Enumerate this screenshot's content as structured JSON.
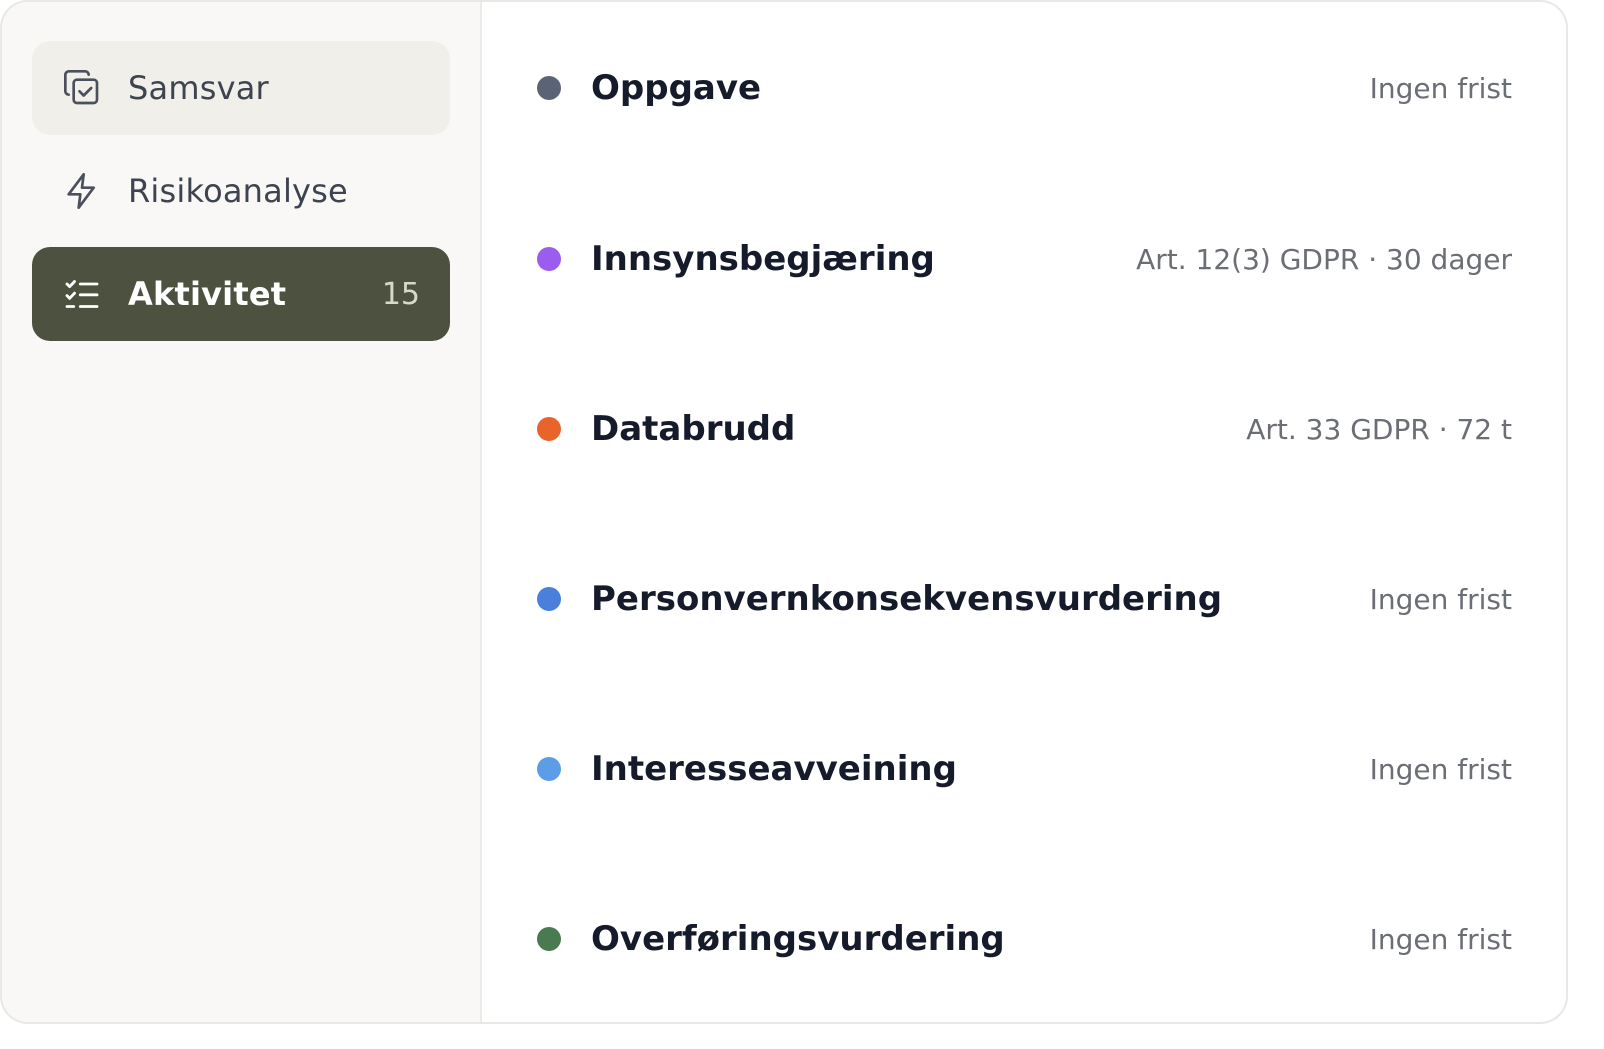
{
  "sidebar": {
    "items": [
      {
        "label": "Samsvar",
        "icon": "compliance-check-icon",
        "state": "hover"
      },
      {
        "label": "Risikoanalyse",
        "icon": "lightning-icon",
        "state": "normal"
      },
      {
        "label": "Aktivitet",
        "icon": "checklist-icon",
        "state": "active",
        "count": "15"
      }
    ]
  },
  "activities": [
    {
      "title": "Oppgave",
      "meta": "Ingen frist",
      "color": "#5b6477"
    },
    {
      "title": "Innsynsbegjæring",
      "meta": "Art. 12(3) GDPR · 30 dager",
      "color": "#9b5cf0"
    },
    {
      "title": "Databrudd",
      "meta": "Art. 33 GDPR · 72 t",
      "color": "#e8642a"
    },
    {
      "title": "Personvernkonsekvensvurdering",
      "meta": "Ingen frist",
      "color": "#4a7fdc"
    },
    {
      "title": "Interesseavveining",
      "meta": "Ingen frist",
      "color": "#5d9de8"
    },
    {
      "title": "Overføringsvurdering",
      "meta": "Ingen frist",
      "color": "#4a7b50"
    }
  ],
  "colors": {
    "active_nav_bg": "#4d5240",
    "hover_nav_bg": "#f0efea",
    "sidebar_bg": "#f9f8f6",
    "title_text": "#161b2b",
    "meta_text": "#6b6e75"
  }
}
